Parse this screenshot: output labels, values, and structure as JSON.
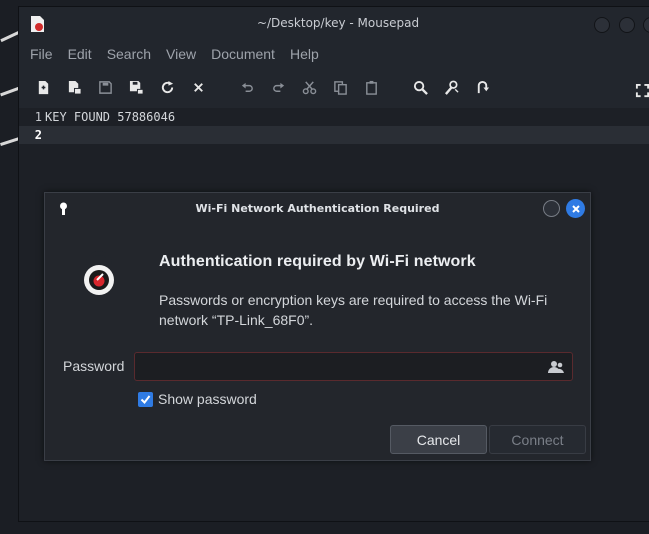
{
  "window": {
    "title": "~/Desktop/key - Mousepad"
  },
  "menubar": [
    "File",
    "Edit",
    "Search",
    "View",
    "Document",
    "Help"
  ],
  "toolbar": {
    "icons": [
      "new-document-icon",
      "new-window-icon",
      "save-icon",
      "save-as-icon",
      "reload-icon",
      "close-tab-icon",
      "undo-icon",
      "redo-icon",
      "cut-icon",
      "copy-icon",
      "paste-icon",
      "find-icon",
      "find-replace-icon",
      "go-to-line-icon",
      "fullscreen-icon"
    ]
  },
  "editor": {
    "lines": [
      {
        "number": "1",
        "text": "KEY FOUND 57886046"
      },
      {
        "number": "2",
        "text": ""
      }
    ]
  },
  "dialog": {
    "title": "Wi-Fi Network Authentication Required",
    "heading": "Authentication required by Wi-Fi network",
    "message": "Passwords or encryption keys are required to access the Wi-Fi network “TP-Link_68F0”.",
    "password_label": "Password",
    "password_value": "",
    "show_password_label": "Show password",
    "show_password_checked": true,
    "cancel_label": "Cancel",
    "connect_label": "Connect",
    "accent_color": "#2f7be4"
  }
}
